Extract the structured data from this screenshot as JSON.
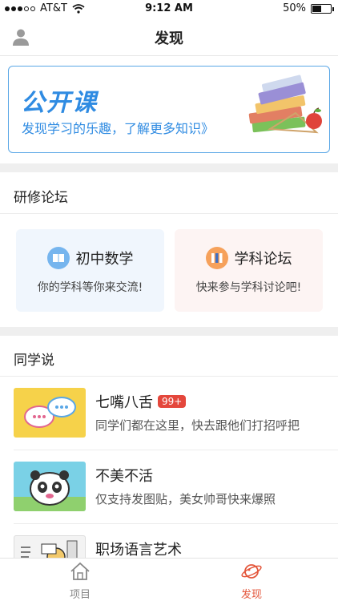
{
  "status_bar": {
    "carrier": "AT&T",
    "time": "9:12 AM",
    "battery": "50%",
    "battery_level": 0.5
  },
  "nav": {
    "title": "发现"
  },
  "banner": {
    "title": "公开课",
    "subtitle": "发现学习的乐趣，了解更多知识》"
  },
  "forum": {
    "section_title": "研修论坛",
    "cards": [
      {
        "name": "初中数学",
        "desc": "你的学科等你来交流!"
      },
      {
        "name": "学科论坛",
        "desc": "快来参与学科讨论吧!"
      }
    ]
  },
  "discussions": {
    "section_title": "同学说",
    "items": [
      {
        "title": "七嘴八舌",
        "badge": "99+",
        "desc": "同学们都在这里，快去跟他们打招呼把"
      },
      {
        "title": "不美不活",
        "desc": "仅支持发图贴，美女帅哥快来爆照"
      },
      {
        "title": "职场语言艺术"
      }
    ]
  },
  "tab_bar": {
    "tabs": [
      {
        "label": "项目"
      },
      {
        "label": "发现"
      }
    ]
  },
  "colors": {
    "accent": "#2f8be2",
    "active_tab": "#e4573c",
    "badge": "#e4473c"
  }
}
